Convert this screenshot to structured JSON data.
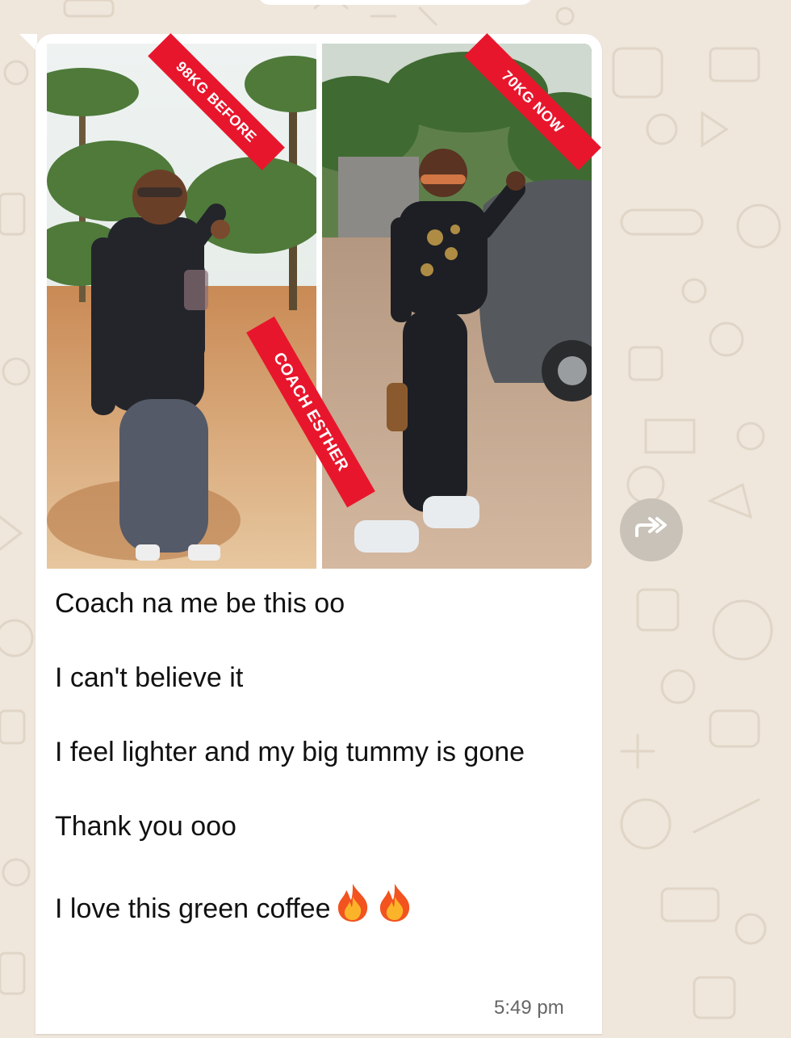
{
  "colors": {
    "wallpaper": "#efe7dc",
    "bubble": "#ffffff",
    "banner": "#e8162c",
    "text": "#111111",
    "timestamp": "#666666"
  },
  "photo": {
    "left_banner": "98KG BEFORE",
    "right_banner": "70KG NOW",
    "center_banner": "COACH ESTHER"
  },
  "message": {
    "lines": [
      "Coach na me be this oo",
      "I can't believe it",
      "I feel lighter and my big tummy is gone",
      "Thank you ooo",
      "I love this green coffee"
    ],
    "emoji_icons": [
      "fire-icon",
      "fire-icon"
    ],
    "time": "5:49 pm"
  },
  "forward_button": {
    "icon": "forward-icon"
  }
}
